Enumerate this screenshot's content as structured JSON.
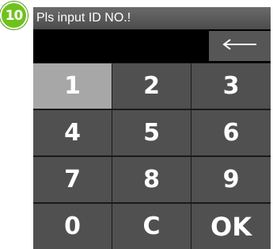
{
  "step": {
    "number": "10",
    "color": "#6fc21c"
  },
  "header": {
    "title": "Pls input ID NO.!"
  },
  "input": {
    "value": "",
    "backspace_icon": "left-arrow-icon"
  },
  "keypad": {
    "active_key": "1",
    "keys": [
      "1",
      "2",
      "3",
      "4",
      "5",
      "6",
      "7",
      "8",
      "9",
      "0",
      "C",
      "OK"
    ]
  },
  "colors": {
    "title_bar": "#5a5a5a",
    "key": "#505050",
    "key_active": "#a7a7a7",
    "screen": "#000000"
  }
}
